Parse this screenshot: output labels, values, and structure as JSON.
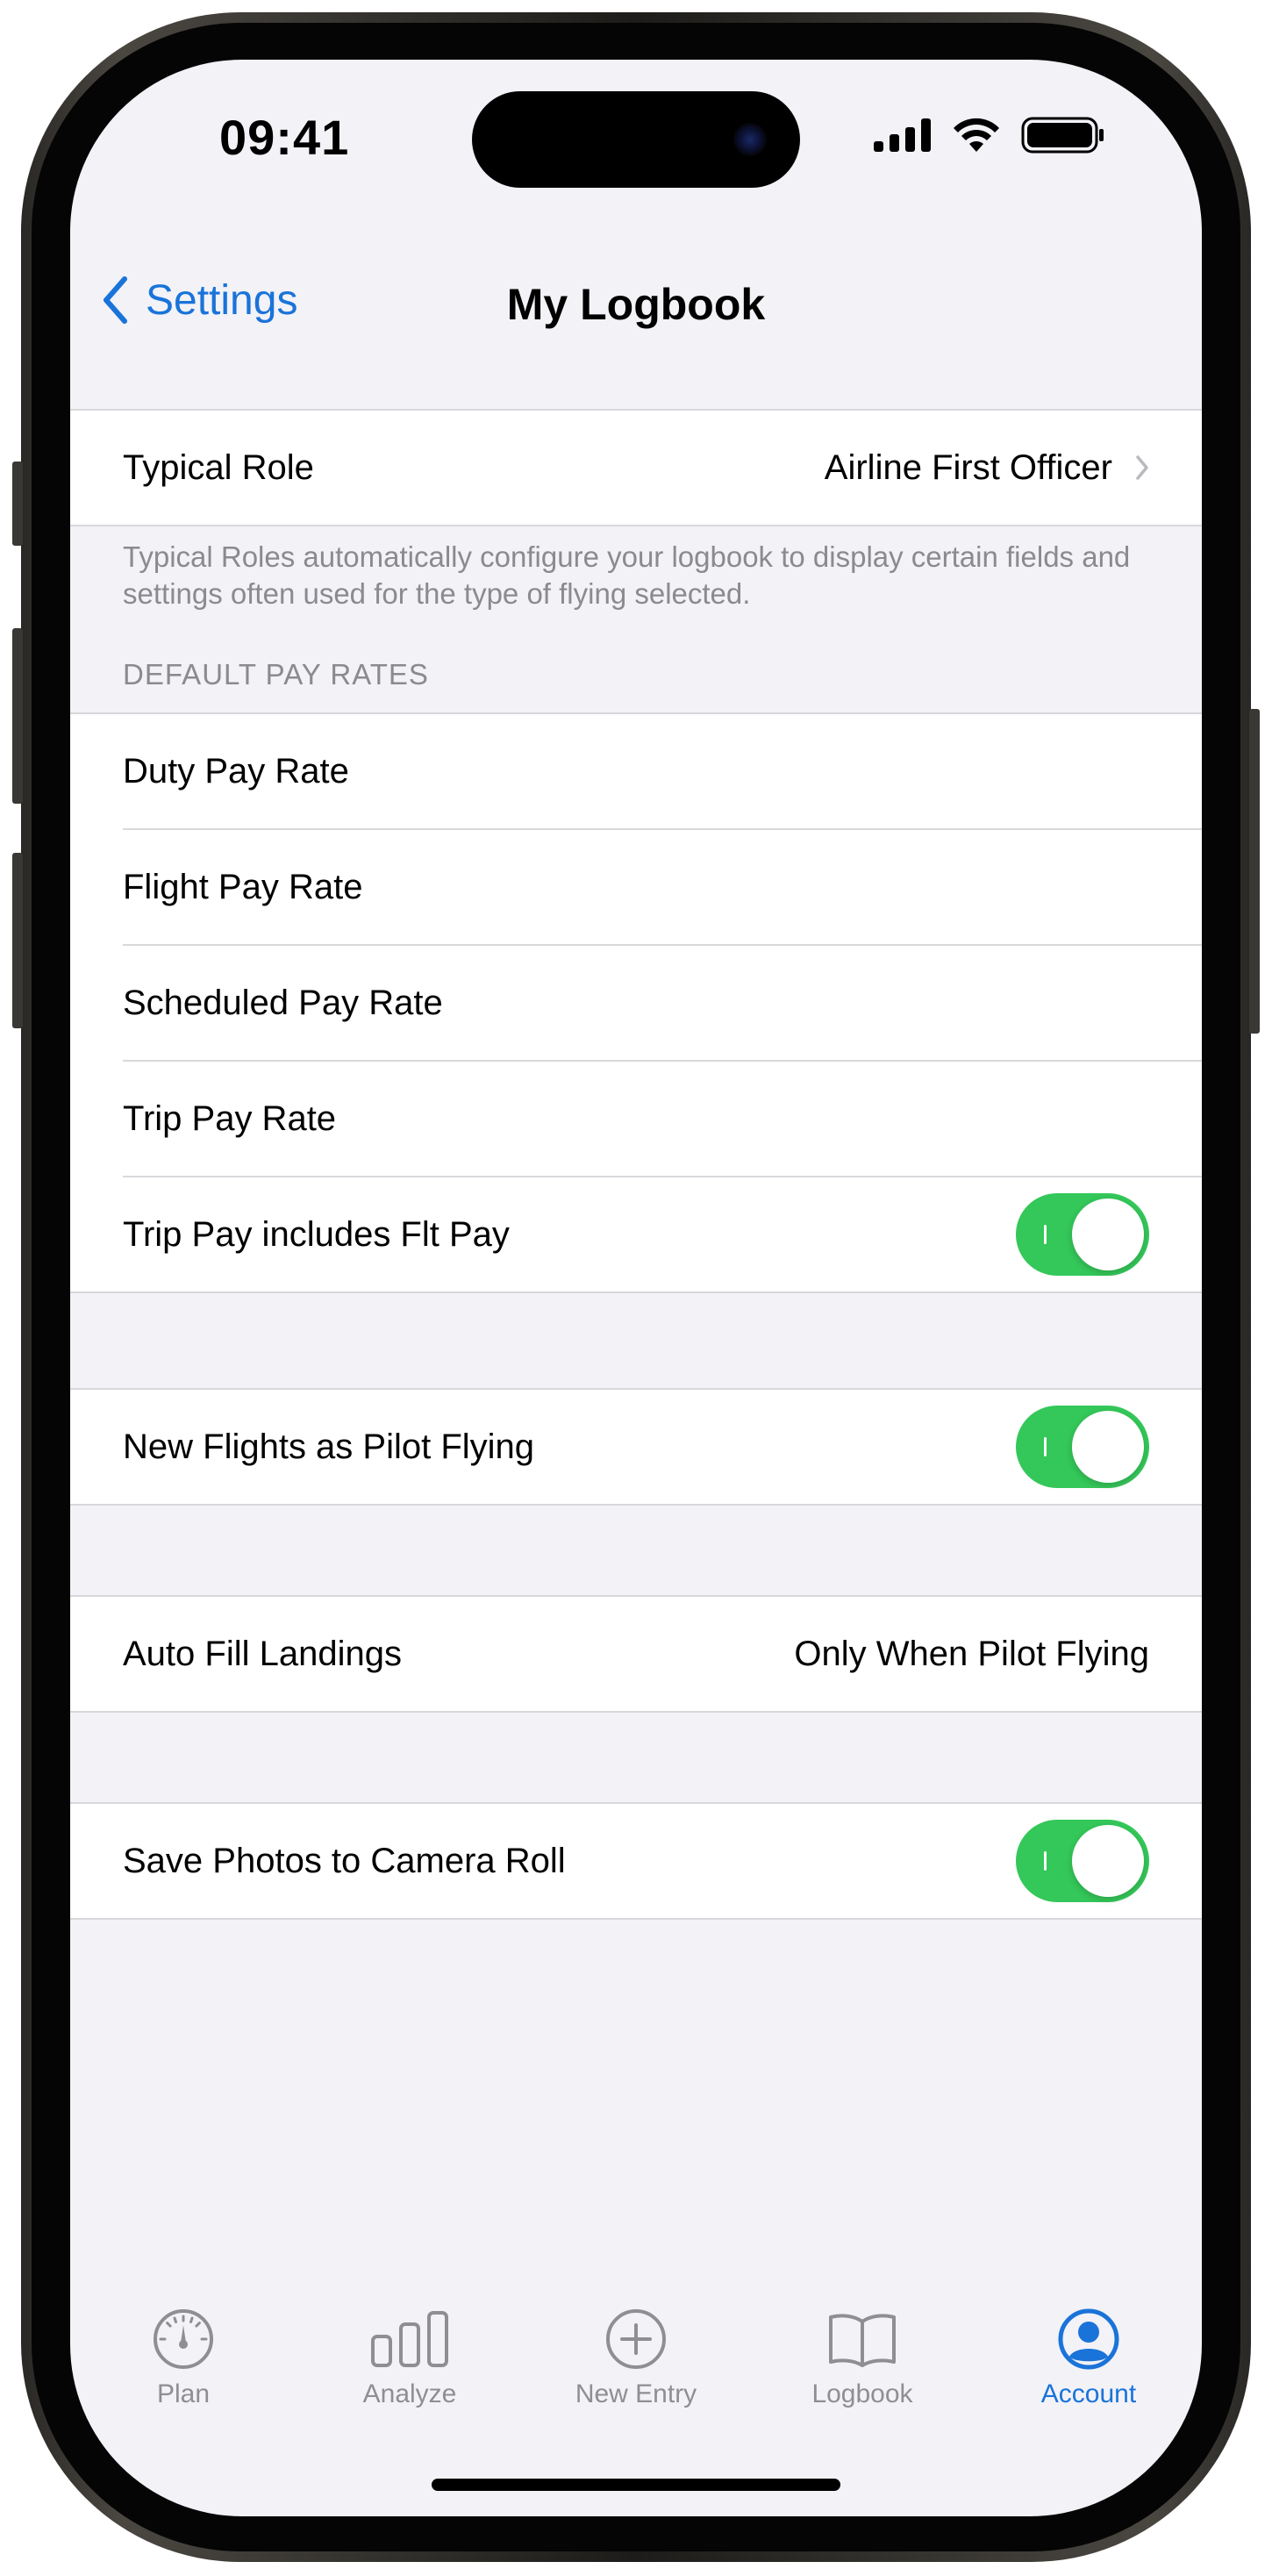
{
  "status": {
    "time": "09:41"
  },
  "nav": {
    "back_label": "Settings",
    "title": "My Logbook"
  },
  "typical_role": {
    "label": "Typical Role",
    "value": "Airline First Officer"
  },
  "typical_role_footnote": "Typical Roles automatically configure your logbook to display certain fields and settings often used for the type of flying selected.",
  "pay_rates": {
    "header": "DEFAULT PAY RATES",
    "rows": [
      {
        "label": "Duty Pay Rate"
      },
      {
        "label": "Flight Pay Rate"
      },
      {
        "label": "Scheduled Pay Rate"
      },
      {
        "label": "Trip Pay Rate"
      },
      {
        "label": "Trip Pay includes Flt Pay",
        "toggle_on": true
      }
    ]
  },
  "pilot_flying": {
    "label": "New Flights as Pilot Flying",
    "toggle_on": true
  },
  "auto_fill": {
    "label": "Auto Fill Landings",
    "value": "Only When Pilot Flying"
  },
  "save_photos": {
    "label": "Save Photos to Camera Roll",
    "toggle_on": true
  },
  "tabs": [
    {
      "label": "Plan",
      "icon": "gauge-icon",
      "active": false
    },
    {
      "label": "Analyze",
      "icon": "bar-chart-icon",
      "active": false
    },
    {
      "label": "New Entry",
      "icon": "plus-circle-icon",
      "active": false
    },
    {
      "label": "Logbook",
      "icon": "book-icon",
      "active": false
    },
    {
      "label": "Account",
      "icon": "person-circle-icon",
      "active": true
    }
  ],
  "colors": {
    "accent": "#1a73d9",
    "toggle_on": "#34c759",
    "background": "#f2f2f7",
    "secondary_text": "#8a8a8f"
  }
}
